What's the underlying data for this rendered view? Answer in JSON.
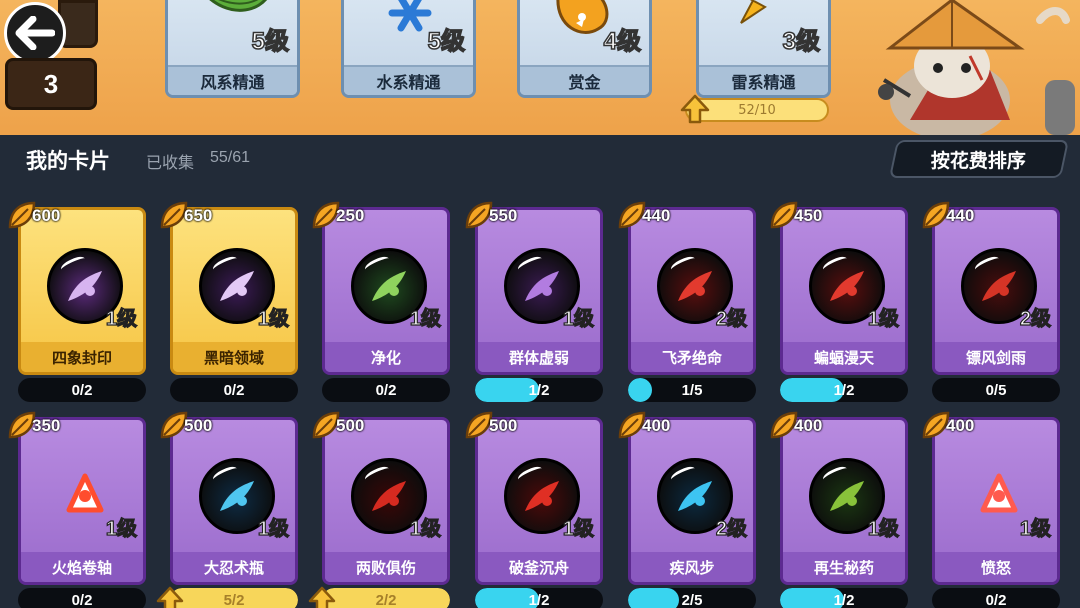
{
  "nav": {
    "level": "3"
  },
  "skills": [
    {
      "name": "风系精通",
      "level": "5级",
      "icon": "green-leaf-icon"
    },
    {
      "name": "水系精通",
      "level": "5级",
      "icon": "blue-snowflake-icon"
    },
    {
      "name": "赏金",
      "level": "4级",
      "icon": "orange-fish-bag-icon"
    },
    {
      "name": "雷系精通",
      "level": "3级",
      "icon": "yellow-lightning-icon"
    }
  ],
  "upgrade": {
    "progress_text": "52/10"
  },
  "header": {
    "title": "我的卡片",
    "collected_label": "已收集",
    "collected_count": "55/61",
    "sort_label": "按花费排序"
  },
  "cards": [
    {
      "name": "四象封印",
      "cost": "600",
      "level": "1级",
      "progress": "0/2",
      "fill": 0,
      "gold": true,
      "ready": false,
      "icon": "seal-icon"
    },
    {
      "name": "黑暗领域",
      "cost": "650",
      "level": "1级",
      "progress": "0/2",
      "fill": 0,
      "gold": true,
      "ready": false,
      "icon": "dark-cloud-icon"
    },
    {
      "name": "净化",
      "cost": "250",
      "level": "1级",
      "progress": "0/2",
      "fill": 0,
      "gold": false,
      "ready": false,
      "icon": "purify-figure-icon"
    },
    {
      "name": "群体虚弱",
      "cost": "550",
      "level": "1级",
      "progress": "1/2",
      "fill": 0.5,
      "gold": false,
      "ready": false,
      "icon": "weak-group-icon"
    },
    {
      "name": "飞矛绝命",
      "cost": "440",
      "level": "2级",
      "progress": "1/5",
      "fill": 0.2,
      "gold": false,
      "ready": false,
      "icon": "flying-spear-icon"
    },
    {
      "name": "蝙蝠漫天",
      "cost": "450",
      "level": "1级",
      "progress": "1/2",
      "fill": 0.5,
      "gold": false,
      "ready": false,
      "icon": "bat-swarm-icon"
    },
    {
      "name": "镖风剑雨",
      "cost": "440",
      "level": "2级",
      "progress": "0/5",
      "fill": 0,
      "gold": false,
      "ready": false,
      "icon": "shuriken-icon"
    },
    {
      "name": "火焰卷轴",
      "cost": "350",
      "level": "1级",
      "progress": "0/2",
      "fill": 0,
      "gold": false,
      "ready": false,
      "icon": "fire-scroll-icon"
    },
    {
      "name": "大忍术瓶",
      "cost": "500",
      "level": "1级",
      "progress": "5/2",
      "fill": 1,
      "gold": false,
      "ready": true,
      "icon": "ninja-bottle-icon"
    },
    {
      "name": "两败俱伤",
      "cost": "500",
      "level": "1级",
      "progress": "2/2",
      "fill": 1,
      "gold": false,
      "ready": true,
      "icon": "mutual-harm-icon"
    },
    {
      "name": "破釜沉舟",
      "cost": "500",
      "level": "1级",
      "progress": "1/2",
      "fill": 0.5,
      "gold": false,
      "ready": false,
      "icon": "blade-slash-icon"
    },
    {
      "name": "疾风步",
      "cost": "400",
      "level": "2级",
      "progress": "2/5",
      "fill": 0.4,
      "gold": false,
      "ready": false,
      "icon": "dash-runner-icon"
    },
    {
      "name": "再生秘药",
      "cost": "400",
      "level": "1级",
      "progress": "1/2",
      "fill": 0.5,
      "gold": false,
      "ready": false,
      "icon": "herbal-medicine-icon"
    },
    {
      "name": "愤怒",
      "cost": "400",
      "level": "1级",
      "progress": "0/2",
      "fill": 0,
      "gold": false,
      "ready": false,
      "icon": "rage-fist-icon"
    }
  ]
}
